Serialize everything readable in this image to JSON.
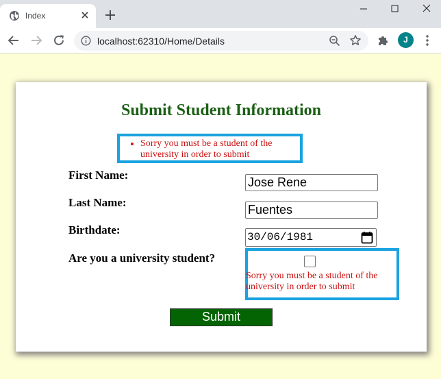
{
  "browser": {
    "tab_title": "Index",
    "url": "localhost:62310/Home/Details",
    "avatar_letter": "J"
  },
  "form": {
    "title": "Submit Student Information",
    "summary_errors": [
      "Sorry you must be a student of the university in order to submit"
    ],
    "first_name_label": "First Name:",
    "first_name_value": "Jose Rene",
    "last_name_label": "Last Name:",
    "last_name_value": "Fuentes",
    "birthdate_label": "Birthdate:",
    "birthdate_value": "30/06/1981",
    "student_label": "Are you a university student?",
    "student_checked": false,
    "student_error": "Sorry you must be a student of the university in order to submit",
    "submit_label": "Submit"
  },
  "colors": {
    "page_bg": "#fefed6",
    "title": "#1a5f14",
    "error": "#cc1111",
    "highlight_border": "#1aa3e0",
    "submit_bg": "#046404"
  }
}
